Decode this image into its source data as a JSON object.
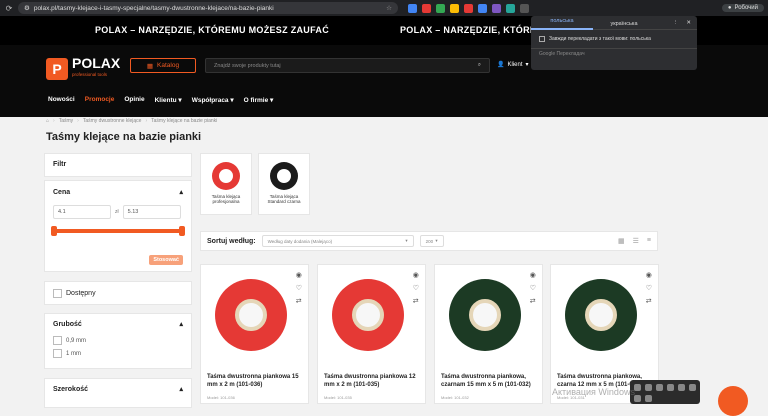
{
  "browser": {
    "url": "polax.pl/tasmy-klejace-i-tasmy-specjalne/tasmy-dwustronne-klejace/na-bazie-pianki",
    "profile_label": "Робочий"
  },
  "banner": {
    "text_left": "POLAX – NARZĘDZIE, KTÓREMU MOŻESZ ZAUFAĆ",
    "text_right": "POLAX – NARZĘDZIE, KTÓREMU MOŻESZ ZAUFAĆ"
  },
  "header": {
    "logo_name": "POLAX",
    "logo_sub": "professional tools",
    "katalog_label": "Katalog",
    "search_placeholder": "Znajdź swoje produkty tutaj",
    "klient_label": "Klient"
  },
  "menu": [
    "Nowości",
    "Promocje",
    "Opinie",
    "Klientu",
    "Współpraca",
    "O firmie"
  ],
  "breadcrumb": [
    "Taśmy",
    "Taśmy dwustronne klejące",
    "Taśmy klejące na bazie pianki"
  ],
  "page_title": "Taśmy klejące na bazie pianki",
  "filters": {
    "title": "Filtr",
    "price_label": "Cena",
    "price_from": "4.1",
    "price_to": "5.13",
    "price_sep": "zł",
    "price_button": "Stosować",
    "available_label": "Dostępny",
    "thickness_label": "Grubość",
    "thickness_options": [
      "0,9 mm",
      "1 mm"
    ],
    "width_label": "Szerokość"
  },
  "categories": [
    {
      "label": "Taśma klejąca profesjonalna",
      "color": "#e53935"
    },
    {
      "label": "Taśma klejąca Standard czarna",
      "color": "#1b1b1b"
    }
  ],
  "sort": {
    "label": "Sortuj według:",
    "option": "Według daty dodania (Malejąco)",
    "per_page": "200"
  },
  "products": [
    {
      "name": "Taśma dwustronna piankowa 15 mm x 2 m (101-036)",
      "model": "Model: 101-036",
      "color": "#e53935"
    },
    {
      "name": "Taśma dwustronna piankowa 12 mm x 2 m (101-035)",
      "model": "Model: 101-035",
      "color": "#e53935"
    },
    {
      "name": "Taśma dwustronna piankowa, czarnam 15 mm x 5 m (101-032)",
      "model": "Model: 101-032",
      "color": "#1c3a24"
    },
    {
      "name": "Taśma dwustronna piankowa, czarna 12 mm x 5 m (101-031)",
      "model": "Model: 101-031",
      "color": "#1c3a24"
    }
  ],
  "translate_popup": {
    "tab_active": "польська",
    "tab_other": "українська",
    "option": "Завжди перекладати з такої мови: польська",
    "footer": "Google Перекладач"
  },
  "os": {
    "watermark": "Активация Windows"
  }
}
